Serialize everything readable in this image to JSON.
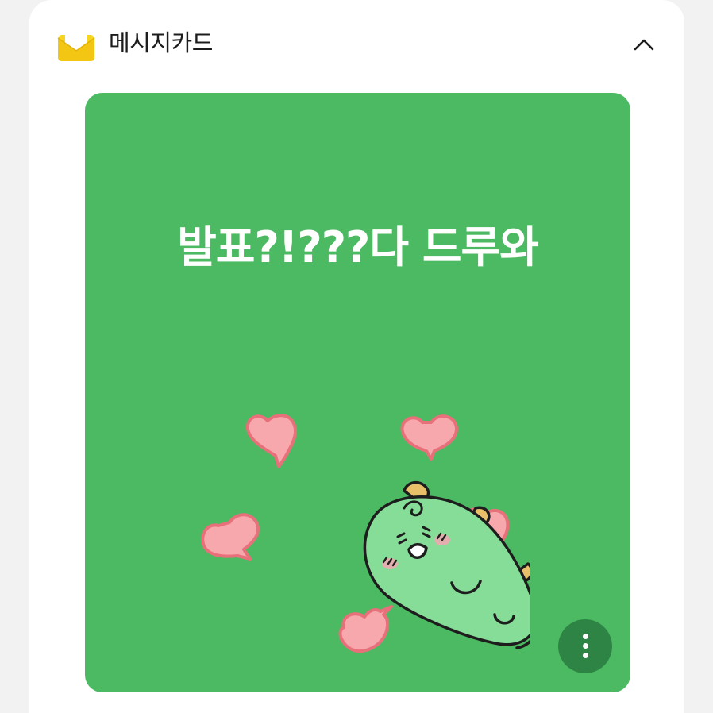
{
  "panel": {
    "title": "메시지카드",
    "icon": "envelope-icon",
    "collapse_icon": "chevron-up-icon",
    "accent_color": "#f7d51e"
  },
  "card": {
    "background_color": "#4cba62",
    "message": "발표?!???다 드루와",
    "sticker": "green-dinosaur-with-hearts-sticker",
    "more_icon": "more-vertical-icon"
  }
}
